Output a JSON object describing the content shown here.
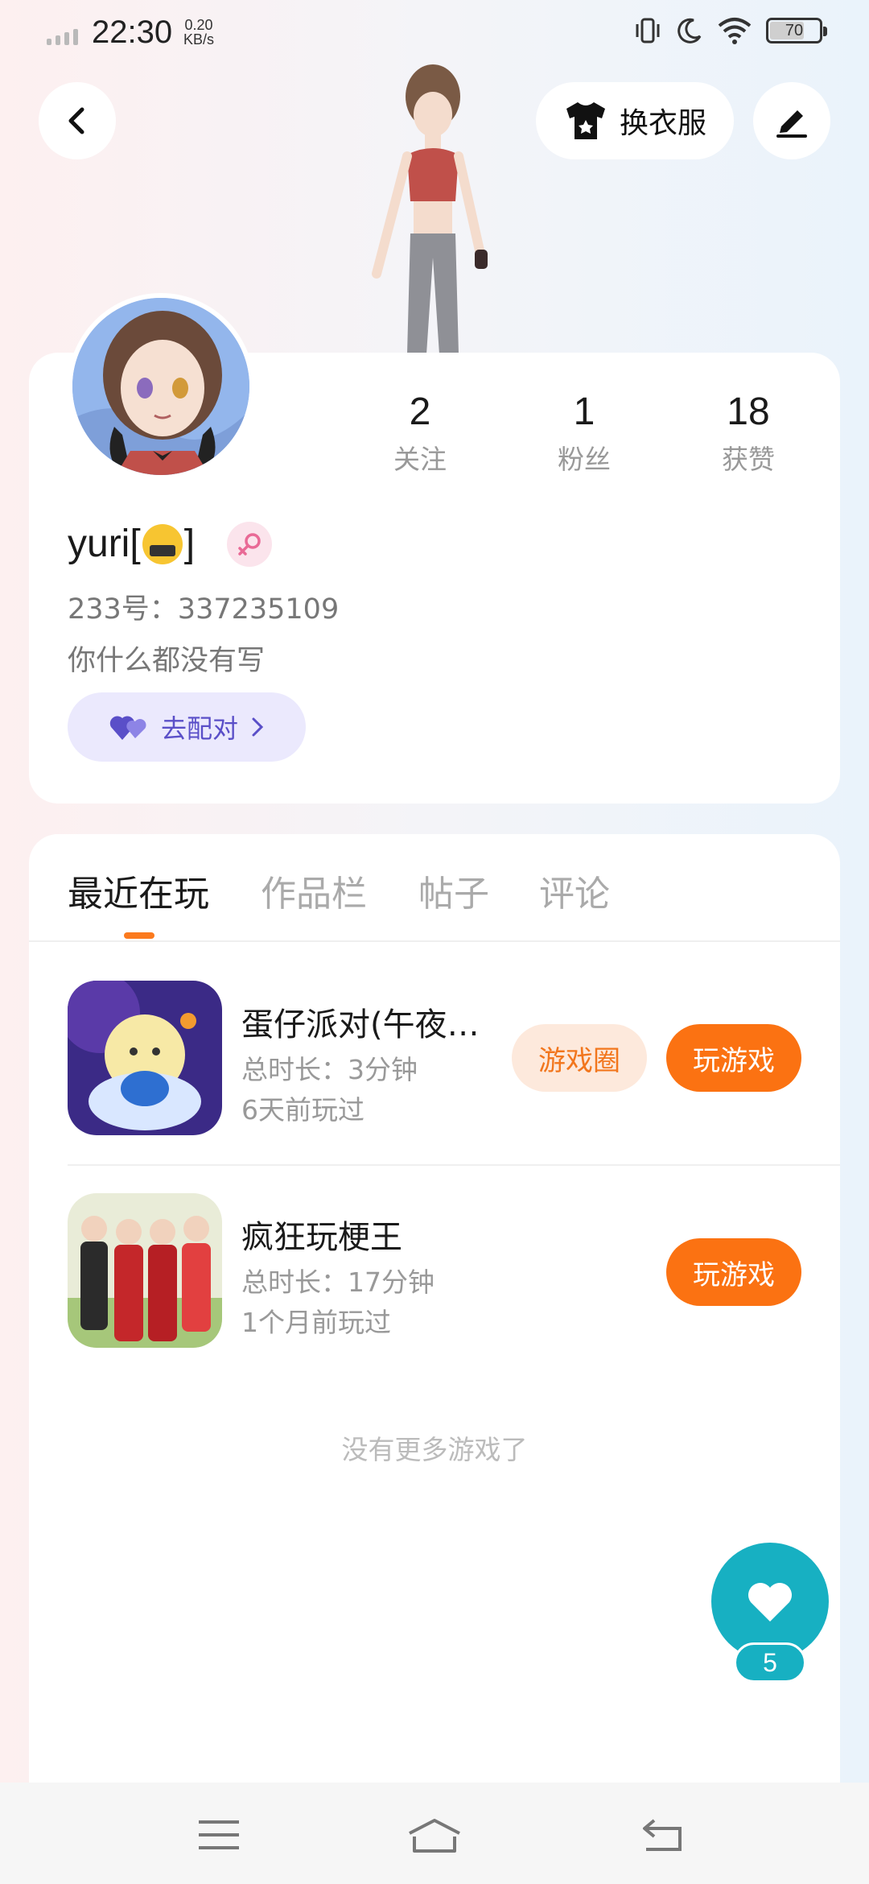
{
  "status_bar": {
    "time": "22:30",
    "net_speed_value": "0.20",
    "net_speed_unit": "KB/s",
    "battery": "70",
    "battery_level": 0.7
  },
  "header": {
    "outfit_label": "换衣服"
  },
  "profile": {
    "username_prefix": "yuri[",
    "username_suffix": "]",
    "uid": "233号：337235109",
    "bio": "你什么都没有写",
    "match_label": "去配对",
    "stats": [
      {
        "value": "2",
        "label": "关注"
      },
      {
        "value": "1",
        "label": "粉丝"
      },
      {
        "value": "18",
        "label": "获赞"
      }
    ]
  },
  "tabs": [
    {
      "label": "最近在玩",
      "active": true
    },
    {
      "label": "作品栏",
      "active": false
    },
    {
      "label": "帖子",
      "active": false
    },
    {
      "label": "评论",
      "active": false
    }
  ],
  "games": [
    {
      "title": "蛋仔派对(午夜…",
      "duration": "总时长：3分钟",
      "last_played": "6天前玩过",
      "circle_label": "游戏圈",
      "play_label": "玩游戏"
    },
    {
      "title": "疯狂玩梗王",
      "duration": "总时长：17分钟",
      "last_played": "1个月前玩过",
      "play_label": "玩游戏"
    }
  ],
  "no_more_text": "没有更多游戏了",
  "like": {
    "count": "5"
  },
  "colors": {
    "accent_orange": "#fb7212",
    "like_teal": "#17b0c2",
    "match_purple": "#5a4fc8"
  }
}
